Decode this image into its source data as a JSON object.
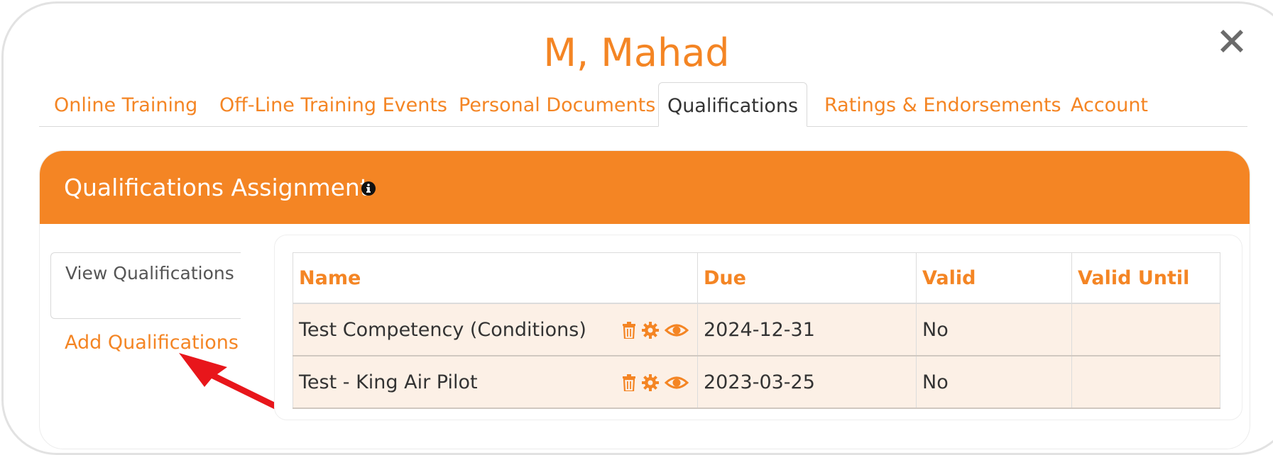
{
  "modal": {
    "title": "M, Mahad"
  },
  "tabs": [
    {
      "label": "Online Training",
      "active": false
    },
    {
      "label": "Off-Line Training Events",
      "active": false
    },
    {
      "label": "Personal Documents",
      "active": false
    },
    {
      "label": "Qualifications",
      "active": true
    },
    {
      "label": "Ratings & Endorsements",
      "active": false
    },
    {
      "label": "Account",
      "active": false
    }
  ],
  "panel": {
    "title": "Qualifications Assignment",
    "info_icon": "info-circle-icon"
  },
  "side_nav": {
    "view_label": "View Qualifications",
    "add_label": "Add Qualifications"
  },
  "table": {
    "columns": [
      "Name",
      "Due",
      "Valid",
      "Valid Until"
    ],
    "rows": [
      {
        "name": "Test Competency (Conditions)",
        "due": "2024-12-31",
        "valid": "No",
        "valid_until": ""
      },
      {
        "name": "Test - King Air Pilot",
        "due": "2023-03-25",
        "valid": "No",
        "valid_until": ""
      }
    ],
    "row_actions": [
      "trash-icon",
      "gear-icon",
      "eye-icon"
    ]
  },
  "colors": {
    "accent": "#f48524",
    "row_bg": "#fcf0e6",
    "annotation_arrow": "#e8161b"
  }
}
